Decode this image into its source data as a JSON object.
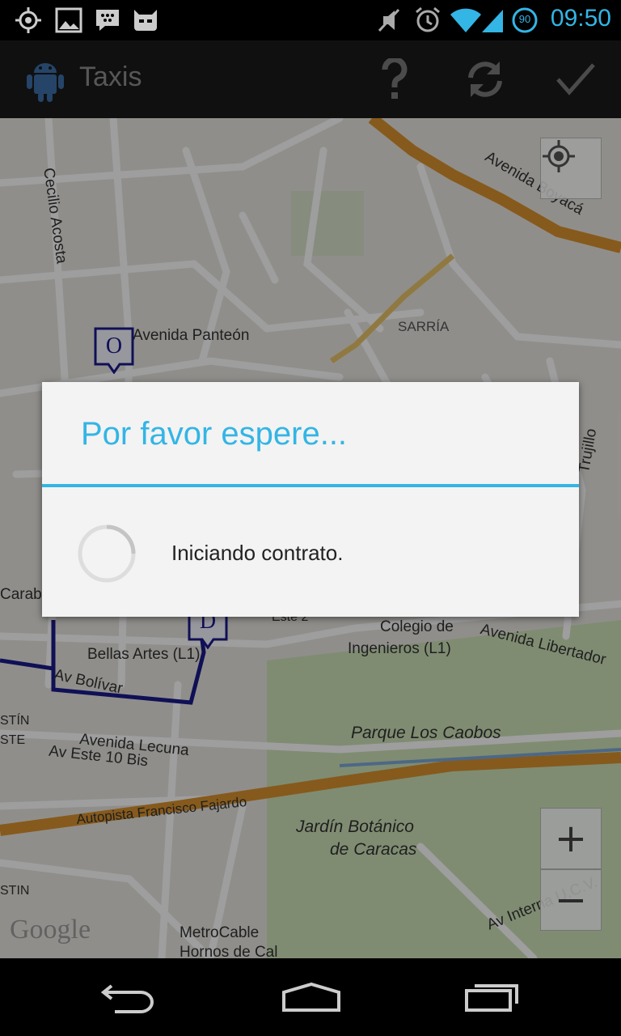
{
  "status_bar": {
    "time": "09:50",
    "battery_level": "90",
    "icons": [
      "gps-icon",
      "image-icon",
      "blackberry-icon",
      "cyanogen-icon",
      "mute-icon",
      "alarm-icon",
      "wifi-icon",
      "signal-icon",
      "battery-icon"
    ]
  },
  "action_bar": {
    "title": "Taxis",
    "actions": [
      "help-icon",
      "refresh-icon",
      "check-icon"
    ]
  },
  "map": {
    "labels": {
      "cecilio_acosta": "Cecilio Acosta",
      "avenida_boyaca": "Avenida Boyacá",
      "avenida_panteon": "Avenida Panteón",
      "sarria": "SARRÍA",
      "trujillo": "Trujillo",
      "carabobo": "Carabo",
      "este2": "Este 2",
      "colegio": "Colegio de",
      "ingenieros": "Ingenieros (L1)",
      "avenida_libertador": "Avenida Libertador",
      "bellas_artes": "Bellas Artes (L1)",
      "av_bolivar": "Av Bolívar",
      "stin1": "STÍN",
      "ste": "STE",
      "avenida_lecuna": "Avenida Lecuna",
      "av_este_10": "Av Este 10 Bis",
      "parque": "Parque Los Caobos",
      "autopista": "Autopista Francisco Fajardo",
      "jardin1": "Jardín Botánico",
      "jardin2": "de Caracas",
      "stin2": "STIN",
      "av_interna": "Av Interna U.C.V.",
      "metrocable1": "MetroCable",
      "metrocable2": "Hornos de Cal",
      "google": "Google"
    },
    "marker_origin": "O",
    "marker_destination": "D",
    "zoom_in": "+",
    "zoom_out": "−"
  },
  "dialog": {
    "title": "Por favor espere...",
    "message": "Iniciando contrato."
  },
  "nav_bar": {
    "buttons": [
      "back-icon",
      "home-icon",
      "recents-icon"
    ]
  },
  "colors": {
    "accent": "#33b5e5",
    "route": "#1a1a8c",
    "highway": "#f2a33a"
  }
}
